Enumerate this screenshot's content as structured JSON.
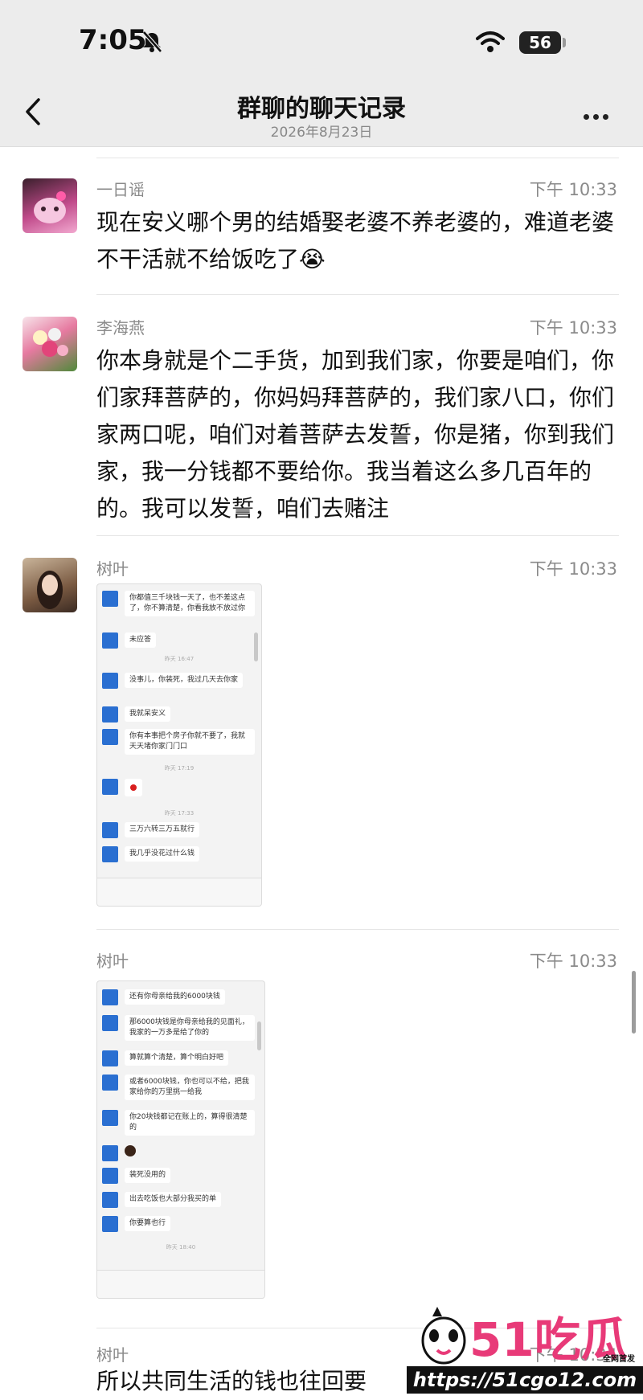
{
  "status": {
    "time": "7:05",
    "battery": "56"
  },
  "header": {
    "title": "群聊的聊天记录",
    "date": "2026年8月23日"
  },
  "messages": [
    {
      "sender": "一日谣",
      "time": "下午 10:33",
      "text": "现在安义哪个男的结婚娶老婆不养老婆的，难道老婆不干活就不给饭吃了😭"
    },
    {
      "sender": "李海燕",
      "time": "下午 10:33",
      "text": "你本身就是个二手货，加到我们家，你要是咱们，你们家拜菩萨的，你妈妈拜菩萨的，我们家八口，你们家两口呢，咱们对着菩萨去发誓，你是猪，你到我们家，我一分钱都不要给你。我当着这么多几百年的的。我可以发誓，咱们去赌注"
    },
    {
      "sender": "树叶",
      "time": "下午 10:33",
      "shot_rows": [
        "你都值三千块钱一天了，也不差这点了，你不算清楚，你看我放不放过你",
        "未应答",
        "没事儿，你装死，我过几天去你家",
        "我就呆安义",
        "你有本事把个房子你就不要了，我就天天堵你家门门口",
        "",
        "三万六转三万五就行",
        "我几乎没花过什么钱"
      ],
      "shot_times": [
        "昨天 16:47",
        "昨天 17:19",
        "昨天 17:33"
      ]
    },
    {
      "sender": "树叶",
      "time": "下午 10:33",
      "shot_rows": [
        "还有你母亲给我的6000块钱",
        "那6000块钱是你母亲给我的见面礼，我家的一万多是给了你的",
        "算就算个清楚，算个明白好吧",
        "或者6000块钱，你也可以不给，把我家给你的万里挑一给我",
        "你20块钱都记在账上的，算得很清楚的",
        "",
        "装死没用的",
        "出去吃饭也大部分我买的单",
        "你要算也行"
      ],
      "shot_times": [
        "昨天 18:40"
      ]
    },
    {
      "sender": "树叶",
      "time": "下午 10:34",
      "text": "所以共同生活的钱也往回要"
    }
  ],
  "watermark": {
    "logo": "51吃瓜",
    "tag": "全网首发",
    "url": "https://51cgo12.com"
  }
}
